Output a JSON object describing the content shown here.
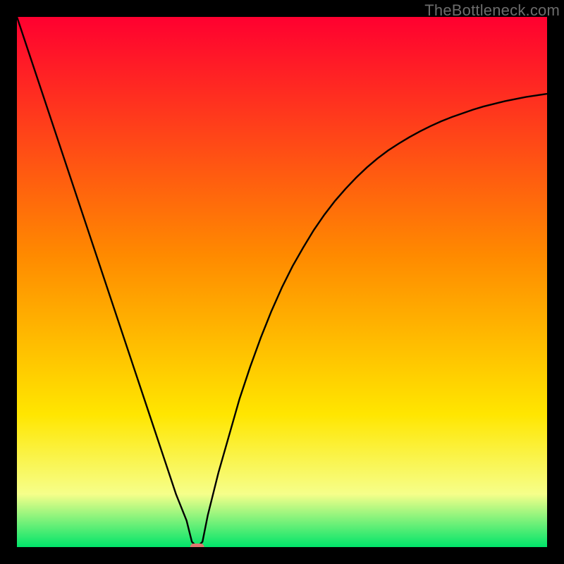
{
  "watermark": "TheBottleneck.com",
  "colors": {
    "gradient_top": "#ff0030",
    "gradient_mid1": "#ff8a00",
    "gradient_mid2": "#ffe600",
    "gradient_band": "#f6ff8a",
    "gradient_bottom": "#00e46a",
    "curve": "#000000",
    "marker": "#e0776f",
    "frame": "#000000"
  },
  "chart_data": {
    "type": "line",
    "title": "",
    "xlabel": "",
    "ylabel": "",
    "xlim": [
      0,
      100
    ],
    "ylim": [
      0,
      100
    ],
    "x": [
      0,
      2,
      4,
      6,
      8,
      10,
      12,
      14,
      16,
      18,
      20,
      22,
      24,
      26,
      28,
      30,
      32,
      33,
      34,
      35,
      36,
      38,
      40,
      42,
      44,
      46,
      48,
      50,
      52,
      54,
      56,
      58,
      60,
      62,
      64,
      66,
      68,
      70,
      72,
      74,
      76,
      78,
      80,
      82,
      84,
      86,
      88,
      90,
      92,
      94,
      96,
      98,
      100
    ],
    "values": [
      100,
      94,
      88,
      82,
      76,
      70,
      64,
      58,
      52,
      46,
      40,
      34,
      28,
      22,
      16,
      10,
      5,
      1,
      0,
      1,
      6,
      14,
      21,
      28,
      34,
      39.5,
      44.5,
      49,
      53,
      56.5,
      59.8,
      62.7,
      65.3,
      67.6,
      69.7,
      71.6,
      73.3,
      74.8,
      76.1,
      77.3,
      78.4,
      79.4,
      80.3,
      81.1,
      81.8,
      82.5,
      83.1,
      83.6,
      84.1,
      84.5,
      84.9,
      85.2,
      85.5
    ],
    "marker": {
      "x": 34,
      "y": 0
    },
    "grid": false,
    "legend": false
  }
}
